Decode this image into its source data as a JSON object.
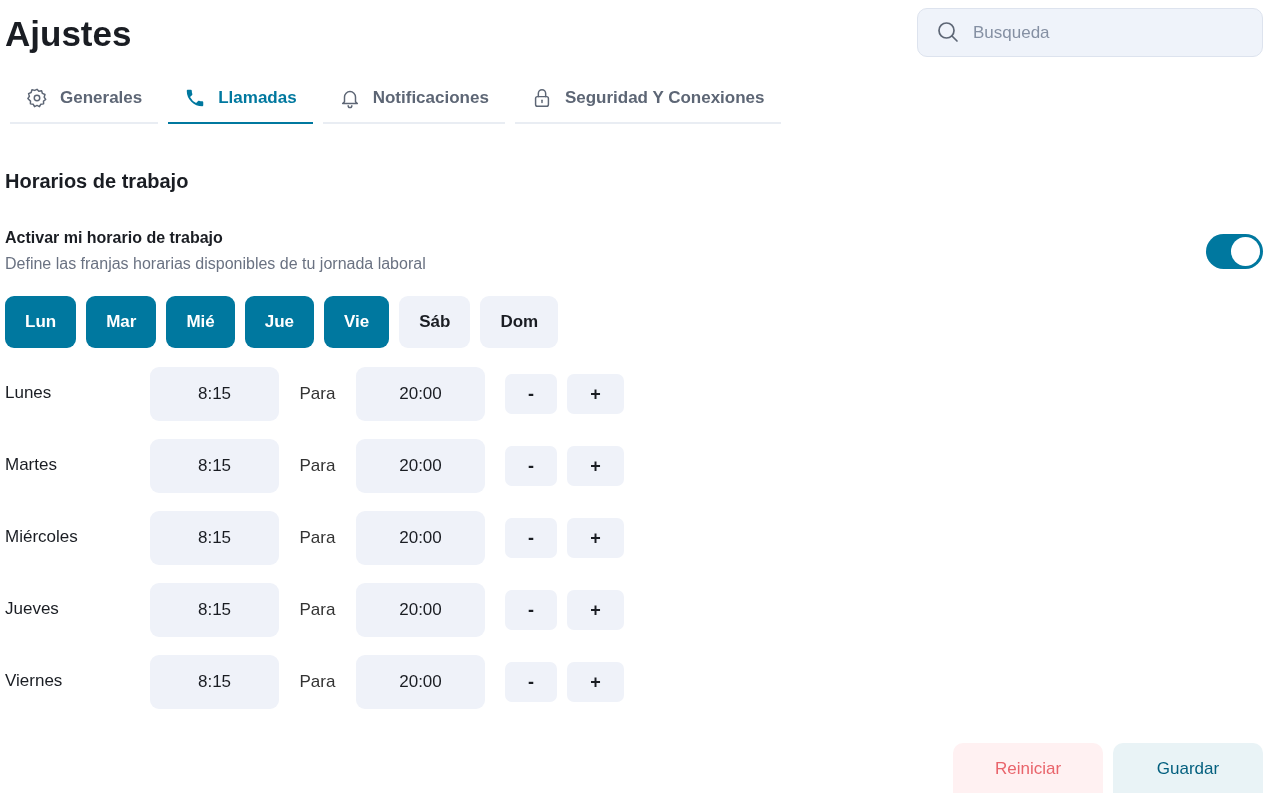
{
  "page": {
    "title": "Ajustes"
  },
  "search": {
    "placeholder": "Busqueda"
  },
  "tabs": [
    {
      "label": "Generales",
      "kind": "gear",
      "selected": false
    },
    {
      "label": "Llamadas",
      "kind": "phone",
      "selected": true
    },
    {
      "label": "Notificaciones",
      "kind": "bell",
      "selected": false
    },
    {
      "label": "Seguridad Y Conexiones",
      "kind": "lock",
      "selected": false
    }
  ],
  "section": {
    "title": "Horarios de trabajo",
    "setting": {
      "label": "Activar mi horario de trabajo",
      "description": "Define las franjas horarias disponibles de tu jornada laboral",
      "on": true
    },
    "days": [
      {
        "label": "Lun",
        "selected": true
      },
      {
        "label": "Mar",
        "selected": true
      },
      {
        "label": "Mié",
        "selected": true
      },
      {
        "label": "Jue",
        "selected": true
      },
      {
        "label": "Vie",
        "selected": true
      },
      {
        "label": "Sáb",
        "selected": false
      },
      {
        "label": "Dom",
        "selected": false
      }
    ],
    "schedule": [
      {
        "day": "Lunes",
        "from": "8:15",
        "separator": "Para",
        "to": "20:00",
        "remove": "-",
        "add": "+"
      },
      {
        "day": "Martes",
        "from": "8:15",
        "separator": "Para",
        "to": "20:00",
        "remove": "-",
        "add": "+"
      },
      {
        "day": "Miércoles",
        "from": "8:15",
        "separator": "Para",
        "to": "20:00",
        "remove": "-",
        "add": "+"
      },
      {
        "day": "Jueves",
        "from": "8:15",
        "separator": "Para",
        "to": "20:00",
        "remove": "-",
        "add": "+"
      },
      {
        "day": "Viernes",
        "from": "8:15",
        "separator": "Para",
        "to": "20:00",
        "remove": "-",
        "add": "+"
      }
    ]
  },
  "buttons": [
    {
      "label": "Reiniciar",
      "kind": "reset"
    },
    {
      "label": "Guardar",
      "kind": "save"
    }
  ]
}
